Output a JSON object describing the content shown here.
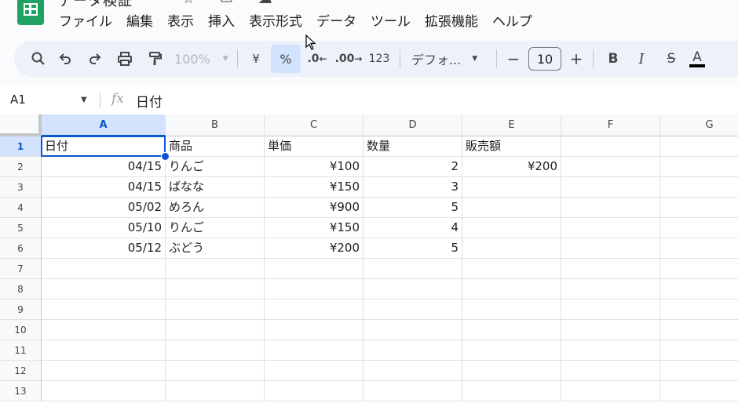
{
  "app": {
    "title": "データ検証",
    "menu": [
      "ファイル",
      "編集",
      "表示",
      "挿入",
      "表示形式",
      "データ",
      "ツール",
      "拡張機能",
      "ヘルプ"
    ]
  },
  "toolbar": {
    "zoom": "100%",
    "currency_label": "¥",
    "percent_label": "%",
    "decrease_decimal_label": ".0",
    "increase_decimal_label": ".00",
    "number_format_label": "123",
    "font_name": "デフォ...",
    "font_size": "10",
    "minus_label": "−",
    "plus_label": "+",
    "bold_label": "B",
    "italic_label": "I",
    "strike_label": "S",
    "text_color_label": "A"
  },
  "formula_bar": {
    "cell_ref": "A1",
    "fx_label": "fx",
    "value": "日付"
  },
  "sheet": {
    "columns": [
      "A",
      "B",
      "C",
      "D",
      "E",
      "F",
      "G"
    ],
    "rows": [
      "1",
      "2",
      "3",
      "4",
      "5",
      "6",
      "7",
      "8",
      "9",
      "10",
      "11",
      "12",
      "13"
    ],
    "cells": [
      [
        "日付",
        "商品",
        "単価",
        "数量",
        "販売額",
        "",
        ""
      ],
      [
        "04/15",
        "りんご",
        "¥100",
        "2",
        "¥200",
        "",
        ""
      ],
      [
        "04/15",
        "ばなな",
        "¥150",
        "3",
        "",
        "",
        ""
      ],
      [
        "05/02",
        "めろん",
        "¥900",
        "5",
        "",
        "",
        ""
      ],
      [
        "05/10",
        "りんご",
        "¥150",
        "4",
        "",
        "",
        ""
      ],
      [
        "05/12",
        "ぶどう",
        "¥200",
        "5",
        "",
        "",
        ""
      ]
    ],
    "selected_cell": "A1"
  },
  "colors": {
    "accent": "#0b57d0",
    "selection_fill": "#d3e3fd",
    "toolbar_bg": "#edf2fa",
    "logo_green": "#1ea362"
  }
}
